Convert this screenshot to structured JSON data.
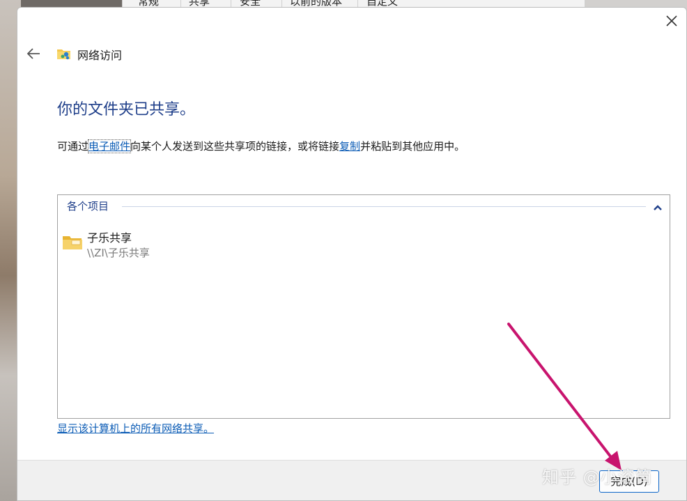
{
  "background_tabs": [
    "常规",
    "共享",
    "安全",
    "以前的版本",
    "自定义"
  ],
  "wizard": {
    "title": "网络访问",
    "heading": "你的文件夹已共享。",
    "description": {
      "part1": "可通过",
      "email_link": "电子邮件",
      "part2": "向某个人发送到这些共享项的链接，或将链接",
      "copy_link": "复制",
      "part3": "并粘贴到其他应用中。"
    },
    "group_label": "各个项目",
    "items": [
      {
        "name": "子乐共享",
        "path": "\\\\ZI\\子乐共享"
      }
    ],
    "show_all_link": "显示该计算机上的所有网络共享。",
    "finish_button": "完成(D)"
  },
  "watermark": "知乎 @小滚筒",
  "colors": {
    "heading": "#1f3f8a",
    "link": "#0a5bb5",
    "annotation_arrow": "#c8146e",
    "button_border": "#0a64c8"
  },
  "icons": {
    "close": "close-icon",
    "back": "back-arrow-icon",
    "wizard": "network-folder-icon",
    "collapse": "chevron-up-icon",
    "folder": "folder-icon"
  }
}
